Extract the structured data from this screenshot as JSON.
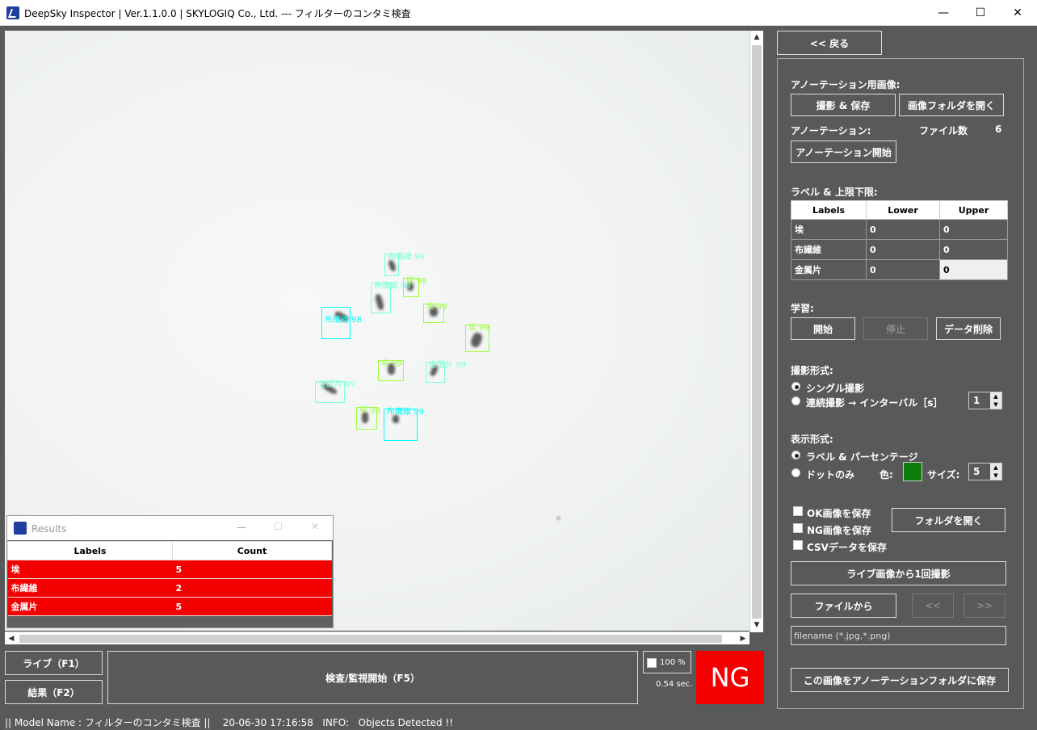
{
  "window": {
    "title": "DeepSky Inspector | Ver.1.1.0.0 | SKYLOGIQ Co., Ltd. --- フィルターのコンタミ検査",
    "minimize": "—",
    "maximize": "☐",
    "close": "✕"
  },
  "detections": [
    {
      "label": "布繊維 99",
      "color": "#7fffd4"
    },
    {
      "label": "埃 98",
      "color": "#9aff3a"
    },
    {
      "label": "布繊維 99",
      "color": "#7fffd4"
    },
    {
      "label": "布繊維 98",
      "color": "#00ffff"
    },
    {
      "label": "埃 99",
      "color": "#9aff3a"
    },
    {
      "label": "埃 99",
      "color": "#9aff3a"
    },
    {
      "label": "埃 99",
      "color": "#9aff3a"
    },
    {
      "label": "金属片 99",
      "color": "#7fffd4"
    },
    {
      "label": "金属片 99",
      "color": "#7fffd4"
    },
    {
      "label": "埃 99",
      "color": "#9aff3a"
    },
    {
      "label": "布繊維 99",
      "color": "#00ffff"
    }
  ],
  "results_window": {
    "title": "Results",
    "columns": [
      "Labels",
      "Count"
    ],
    "rows": [
      {
        "label": "埃",
        "count": "5"
      },
      {
        "label": "布繊維",
        "count": "2"
      },
      {
        "label": "金属片",
        "count": "5"
      }
    ]
  },
  "bottom": {
    "live_button": "ライブ（F1）",
    "results_button": "結果（F2）",
    "inspect_button": "検査/監視開始（F5）",
    "zoom_label": "100 %",
    "elapsed": "0.54 sec.",
    "verdict": "NG",
    "verdict_color": "#f40000"
  },
  "panel": {
    "back_button": "<< 戻る",
    "annotation_images_header": "アノーテーション用画像:",
    "capture_save_button": "撮影 & 保存",
    "open_image_folder_button": "画像フォルダを開く",
    "annotation_header": "アノーテーション:",
    "file_count_label": "ファイル数",
    "file_count_value": "6",
    "start_annotation_button": "アノーテーション開始",
    "label_limits_header": "ラベル & 上限下限:",
    "label_table": {
      "columns": [
        "Labels",
        "Lower",
        "Upper"
      ],
      "rows": [
        {
          "label": "埃",
          "lower": "0",
          "upper": "0"
        },
        {
          "label": "布繊維",
          "lower": "0",
          "upper": "0"
        },
        {
          "label": "金属片",
          "lower": "0",
          "upper": "0"
        }
      ]
    },
    "learning_header": "学習:",
    "start_button": "開始",
    "stop_button": "停止",
    "delete_data_button": "データ削除",
    "capture_mode_header": "撮影形式:",
    "single_capture": "シングル撮影",
    "continuous_capture": "連続撮影 → インターバル［s］",
    "interval_value": "1",
    "display_mode_header": "表示形式:",
    "label_percentage": "ラベル & パーセンテージ",
    "dots_only": "ドットのみ",
    "color_label": "色:",
    "dot_color": "#0a7d0a",
    "size_label": "サイズ:",
    "size_value": "5",
    "save_ok": "OK画像を保存",
    "save_ng": "NG画像を保存",
    "save_csv": "CSVデータを保存",
    "open_folder_button": "フォルダを開く",
    "capture_once_button": "ライブ画像から1回撮影",
    "from_file_button": "ファイルから",
    "prev_button": "<<",
    "next_button": ">>",
    "filename_placeholder": "filename (*.jpg,*.png)",
    "save_to_annotation_button": "この画像をアノーテーションフォルダに保存"
  },
  "status": {
    "text": "|| Model Name : フィルターのコンタミ検査 ||    20-06-30 17:16:58   INFO:   Objects Detected !!"
  }
}
